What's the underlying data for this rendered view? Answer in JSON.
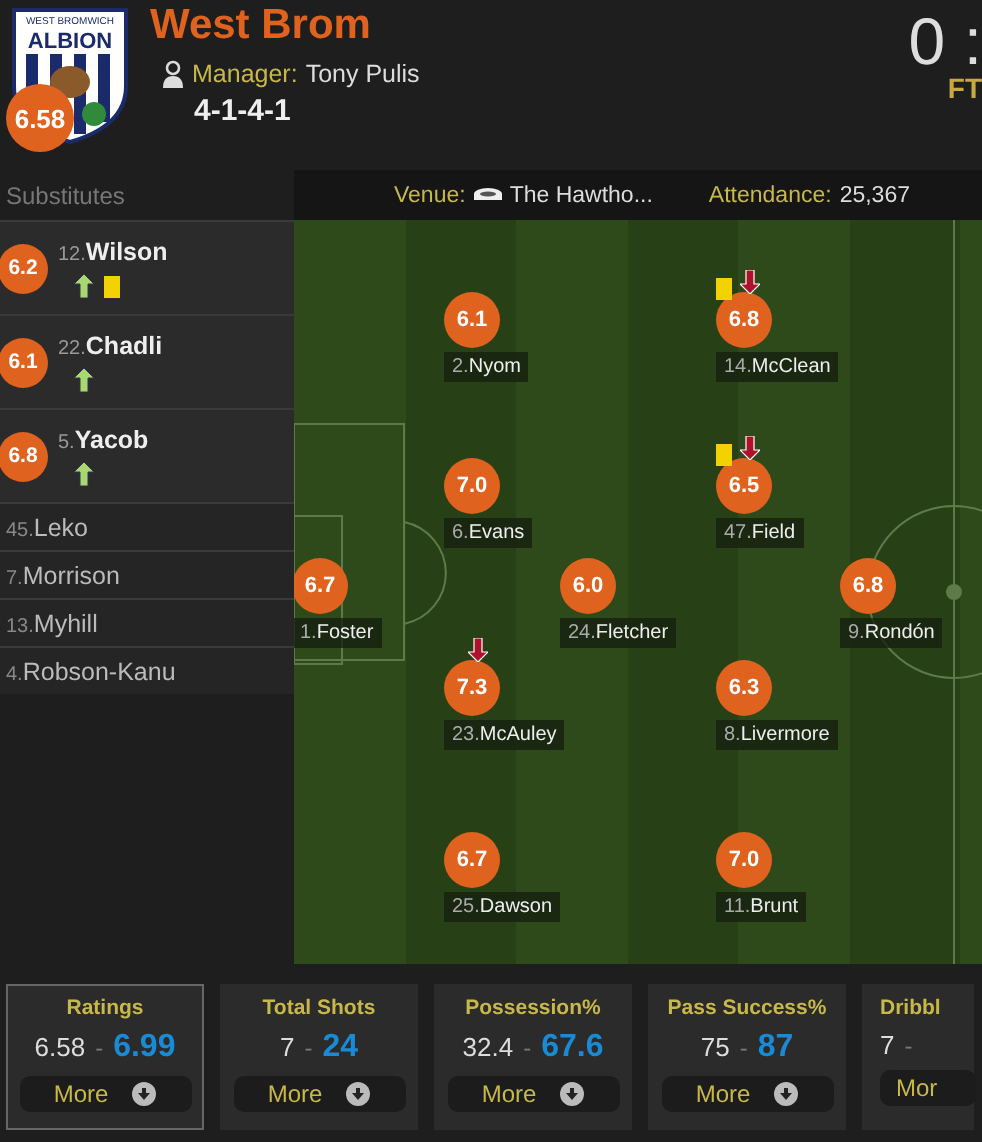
{
  "team": {
    "logo_text": [
      "WEST BROMWICH",
      "ALBION"
    ],
    "rating": "6.58",
    "name": "West Brom",
    "manager_label": "Manager:",
    "manager": "Tony Pulis",
    "formation": "4-1-4-1"
  },
  "score": {
    "value": "0 :",
    "status": "FT"
  },
  "substitutes": {
    "title": "Substitutes",
    "players": [
      {
        "number": "12.",
        "name": "Wilson",
        "rating": "6.2",
        "subbed_on": true,
        "yellow_card": true
      },
      {
        "number": "22.",
        "name": "Chadli",
        "rating": "6.1",
        "subbed_on": true,
        "yellow_card": false
      },
      {
        "number": "5.",
        "name": "Yacob",
        "rating": "6.8",
        "subbed_on": true,
        "yellow_card": false
      },
      {
        "number": "45.",
        "name": "Leko"
      },
      {
        "number": "7.",
        "name": "Morrison"
      },
      {
        "number": "13.",
        "name": "Myhill"
      },
      {
        "number": "4.",
        "name": "Robson-Kanu"
      }
    ]
  },
  "match_info": {
    "venue_label": "Venue:",
    "venue": "The Hawtho...",
    "attendance_label": "Attendance:",
    "attendance": "25,367"
  },
  "lines": [
    {
      "players": [
        {
          "number": "1.",
          "name": "Foster",
          "rating": "6.7",
          "yellow_card": false,
          "subbed_off": false
        }
      ]
    },
    {
      "players": [
        {
          "number": "2.",
          "name": "Nyom",
          "rating": "6.1",
          "yellow_card": false,
          "subbed_off": false
        },
        {
          "number": "6.",
          "name": "Evans",
          "rating": "7.0",
          "yellow_card": false,
          "subbed_off": false
        },
        {
          "number": "23.",
          "name": "McAuley",
          "rating": "7.3",
          "yellow_card": false,
          "subbed_off": true
        },
        {
          "number": "25.",
          "name": "Dawson",
          "rating": "6.7",
          "yellow_card": false,
          "subbed_off": false
        }
      ]
    },
    {
      "players": [
        {
          "number": "24.",
          "name": "Fletcher",
          "rating": "6.0",
          "yellow_card": false,
          "subbed_off": false
        }
      ]
    },
    {
      "players": [
        {
          "number": "14.",
          "name": "McClean",
          "rating": "6.8",
          "yellow_card": true,
          "subbed_off": true
        },
        {
          "number": "47.",
          "name": "Field",
          "rating": "6.5",
          "yellow_card": true,
          "subbed_off": true
        },
        {
          "number": "8.",
          "name": "Livermore",
          "rating": "6.3",
          "yellow_card": false,
          "subbed_off": false
        },
        {
          "number": "11.",
          "name": "Brunt",
          "rating": "7.0",
          "yellow_card": false,
          "subbed_off": false
        }
      ]
    },
    {
      "players": [
        {
          "number": "9.",
          "name": "Rondón",
          "rating": "6.8",
          "yellow_card": false,
          "subbed_off": false
        }
      ]
    }
  ],
  "stats": [
    {
      "title": "Ratings",
      "home": "6.58",
      "separator": "-",
      "away": "6.99",
      "more": "More",
      "selected": true
    },
    {
      "title": "Total Shots",
      "home": "7",
      "separator": "-",
      "away": "24",
      "more": "More",
      "selected": false
    },
    {
      "title": "Possession%",
      "home": "32.4",
      "separator": "-",
      "away": "67.6",
      "more": "More",
      "selected": false
    },
    {
      "title": "Pass Success%",
      "home": "75",
      "separator": "-",
      "away": "87",
      "more": "More",
      "selected": false
    },
    {
      "title": "Dribbl",
      "home": "7",
      "separator": "-",
      "more": "Mor",
      "selected": false
    }
  ]
}
